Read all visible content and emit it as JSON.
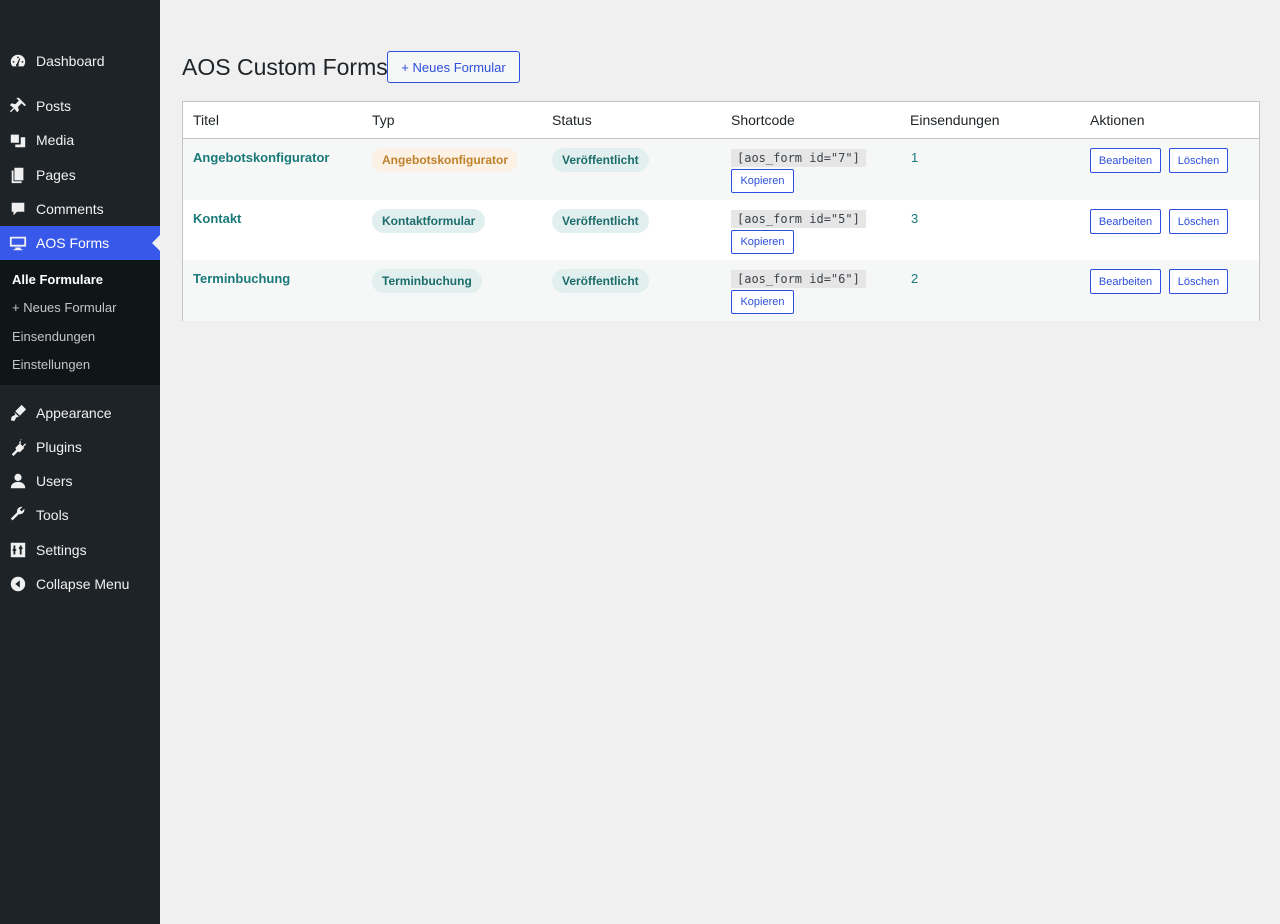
{
  "sidebar": {
    "items": [
      {
        "label": "Dashboard",
        "icon": "dashboard-icon"
      },
      {
        "label": "Posts",
        "icon": "pin-icon"
      },
      {
        "label": "Media",
        "icon": "media-icon"
      },
      {
        "label": "Pages",
        "icon": "pages-icon"
      },
      {
        "label": "Comments",
        "icon": "comment-icon"
      },
      {
        "label": "AOS Forms",
        "icon": "monitor-icon"
      },
      {
        "label": "Appearance",
        "icon": "brush-icon"
      },
      {
        "label": "Plugins",
        "icon": "plug-icon"
      },
      {
        "label": "Users",
        "icon": "user-icon"
      },
      {
        "label": "Tools",
        "icon": "wrench-icon"
      },
      {
        "label": "Settings",
        "icon": "sliders-icon"
      },
      {
        "label": "Collapse Menu",
        "icon": "collapse-icon"
      }
    ],
    "current": "AOS Forms",
    "submenu": [
      {
        "label": "Alle Formulare"
      },
      {
        "label": "+ Neues Formular"
      },
      {
        "label": "Einsendungen"
      },
      {
        "label": "Einstellungen"
      }
    ]
  },
  "main": {
    "title": "AOS Custom Forms",
    "add_button": "+ Neues Formular",
    "table": {
      "headers": [
        "Titel",
        "Typ",
        "Status",
        "Shortcode",
        "Einsendungen",
        "Aktionen"
      ],
      "rows": [
        {
          "title": "Angebotskonfigurator",
          "type": "Angebotskonfigurator",
          "type_color": "#c0812c",
          "status": "Veröffentlicht",
          "shortcode": "[aos_form id=\"7\"]",
          "copy": "Kopieren",
          "submissions": "1",
          "edit": "Bearbeiten",
          "delete": "Löschen"
        },
        {
          "title": "Kontakt",
          "type": "Kontaktformular",
          "type_color": "#1d6b6b",
          "status": "Veröffentlicht",
          "shortcode": "[aos_form id=\"5\"]",
          "copy": "Kopieren",
          "submissions": "3",
          "edit": "Bearbeiten",
          "delete": "Löschen"
        },
        {
          "title": "Terminbuchung",
          "type": "Terminbuchung",
          "type_color": "#1d6b6b",
          "status": "Veröffentlicht",
          "shortcode": "[aos_form id=\"6\"]",
          "copy": "Kopieren",
          "submissions": "2",
          "edit": "Bearbeiten",
          "delete": "Löschen"
        }
      ]
    }
  },
  "colors": {
    "sidebar_bg": "#1d2327",
    "submenu_bg": "#101517",
    "accent": "#3858e9",
    "link_teal": "#1a7a7a",
    "button_blue": "#2c4fdd"
  }
}
